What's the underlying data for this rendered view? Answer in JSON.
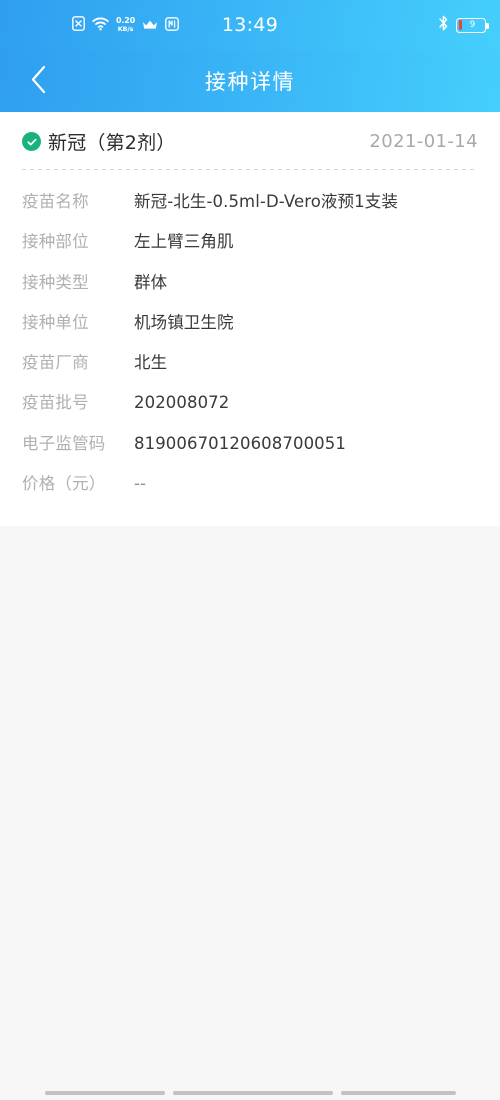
{
  "status_bar": {
    "time": "13:49",
    "network_speed_value": "0.20",
    "network_speed_unit": "KB/s",
    "battery_level": "9",
    "icons": {
      "sim": "sim-card-disabled-icon",
      "wifi": "wifi-icon",
      "crown": "crown-icon",
      "app": "app-badge-icon",
      "bluetooth": "bluetooth-icon",
      "battery": "battery-low-icon"
    }
  },
  "header": {
    "title": "接种详情",
    "back_icon": "chevron-left-icon",
    "gradient_start": "#2f9ef0",
    "gradient_end": "#45cffc"
  },
  "card": {
    "status_icon": "check-circle-icon",
    "status_color": "#17b37a",
    "title": "新冠（第2剂）",
    "date": "2021-01-14",
    "rows": [
      {
        "label": "疫苗名称",
        "value": "新冠-北生-0.5ml-D-Vero液预1支装",
        "muted": false
      },
      {
        "label": "接种部位",
        "value": "左上臂三角肌",
        "muted": false
      },
      {
        "label": "接种类型",
        "value": "群体",
        "muted": false
      },
      {
        "label": "接种单位",
        "value": "机场镇卫生院",
        "muted": false
      },
      {
        "label": "疫苗厂商",
        "value": "北生",
        "muted": false
      },
      {
        "label": "疫苗批号",
        "value": "202008072",
        "muted": false
      },
      {
        "label": "电子监管码",
        "value": "81900670120608700051",
        "muted": false
      },
      {
        "label": "价格（元）",
        "value": "--",
        "muted": true
      }
    ]
  },
  "system_nav": {
    "hint_color": "#c2c2c2"
  }
}
